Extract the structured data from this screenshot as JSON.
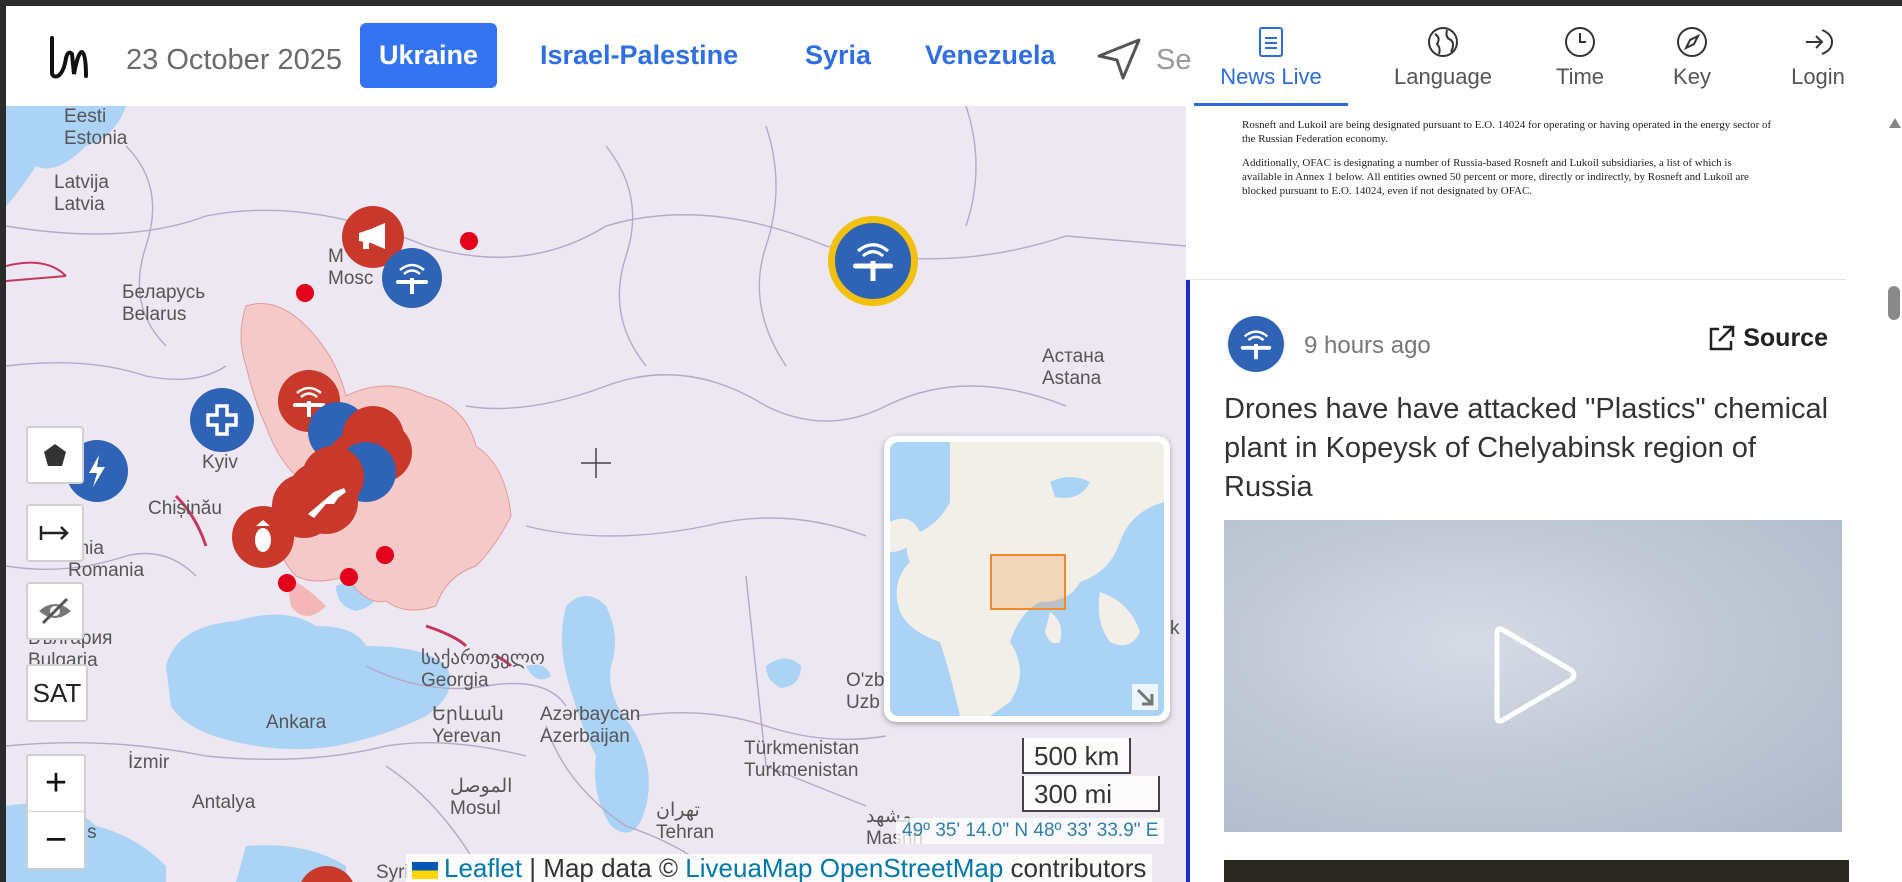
{
  "header": {
    "date": "23 October 2025",
    "tabs": [
      {
        "label": "Ukraine",
        "active": true
      },
      {
        "label": "Israel-Palestine",
        "active": false
      },
      {
        "label": "Syria",
        "active": false
      },
      {
        "label": "Venezuela",
        "active": false
      }
    ],
    "search_label": "Se"
  },
  "panel": {
    "nav": [
      {
        "label": "News Live",
        "icon": "document-icon",
        "active": true
      },
      {
        "label": "Language",
        "icon": "globe-icon",
        "active": false
      },
      {
        "label": "Time",
        "icon": "clock-icon",
        "active": false
      },
      {
        "label": "Key",
        "icon": "compass-icon",
        "active": false
      },
      {
        "label": "Login",
        "icon": "login-icon",
        "active": false
      }
    ],
    "doc_paragraphs": [
      "Rosneft and Lukoil are being designated pursuant to E.O. 14024 for operating or having operated in the energy sector of the Russian Federation economy.",
      "Additionally, OFAC is designating a number of Russia-based Rosneft and Lukoil subsidiaries, a list of which is available in Annex 1 below.  All entities owned 50 percent or more, directly or indirectly, by Rosneft and Lukoil are blocked pursuant to E.O. 14024, even if not designated by OFAC."
    ],
    "card": {
      "time": "9 hours ago",
      "source_label": "Source",
      "headline": "Drones have have attacked \"Plastics\" chemical plant in Kopeysk of Chelyabinsk region of Russia"
    }
  },
  "map": {
    "labels": {
      "estonia": [
        "Eesti",
        "Estonia"
      ],
      "latvia": [
        "Latvija",
        "Latvia"
      ],
      "belarus": [
        "Беларусь",
        "Belarus"
      ],
      "moscow": [
        "M",
        "Mosc"
      ],
      "kyiv": "Kyiv",
      "chisinau": "Chișinău",
      "romania": [
        "ânia",
        "Romania"
      ],
      "bulgaria": [
        "Бългaрия",
        "Bulgaria"
      ],
      "georgia": [
        "საქართველო",
        "Georgia"
      ],
      "astana": [
        "Астана",
        "Astana"
      ],
      "ankara": "Ankara",
      "izmir": "İzmir",
      "antalya": "Antalya",
      "yerevan": [
        "Երևան",
        "Yerevan"
      ],
      "azerbaijan": [
        "Azərbaycan",
        "Azerbaijan"
      ],
      "turkmenistan": [
        "Türkmenistan",
        "Turkmenistan"
      ],
      "uzbek": [
        "O'zb",
        "Uzb"
      ],
      "mosul": [
        "الموصل",
        "Mosul"
      ],
      "tehran": [
        "تهران",
        "Tehran"
      ],
      "mashhad": [
        "مشهد",
        "Mashh"
      ],
      "syria": "Syri",
      "athens": "ens",
      "kaz_edge": "k"
    },
    "controls": {
      "sat": "SAT",
      "zoom_in": "+",
      "zoom_out": "−"
    },
    "scale": {
      "km": "500 km",
      "mi": "300 mi"
    },
    "coordinates": "49º 35' 14.0\" N 48º 33' 33.9\" E",
    "attribution": {
      "leaflet": "Leaflet",
      "sep": " | Map data © ",
      "liveuamap": "LiveuaMap",
      "osm": "OpenStreetMap",
      "contributors": " contributors"
    }
  }
}
